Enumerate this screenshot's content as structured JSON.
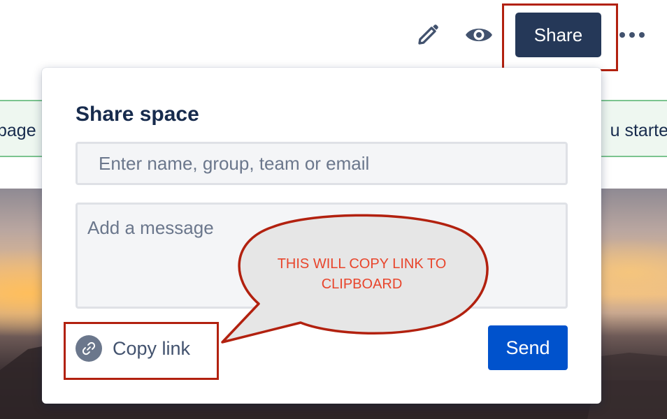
{
  "toolbar": {
    "edit_icon": "pencil-icon",
    "watch_icon": "eye-icon",
    "share_label": "Share",
    "more_icon": "more-horizontal-icon"
  },
  "banner": {
    "left_fragment": "page",
    "right_fragment": "u starte"
  },
  "share_dialog": {
    "title": "Share space",
    "name_placeholder": "Enter name, group, team or email",
    "message_placeholder": "Add a message",
    "copy_link_label": "Copy link",
    "copy_link_icon": "link-icon",
    "send_label": "Send"
  },
  "annotation": {
    "callout_text": "THIS WILL COPY LINK TO CLIPBOARD",
    "highlight_color": "#b2210f",
    "callout_text_color": "#e8452c"
  },
  "colors": {
    "share_button": "#253858",
    "send_button": "#0052cc",
    "title_text": "#172b4d"
  }
}
